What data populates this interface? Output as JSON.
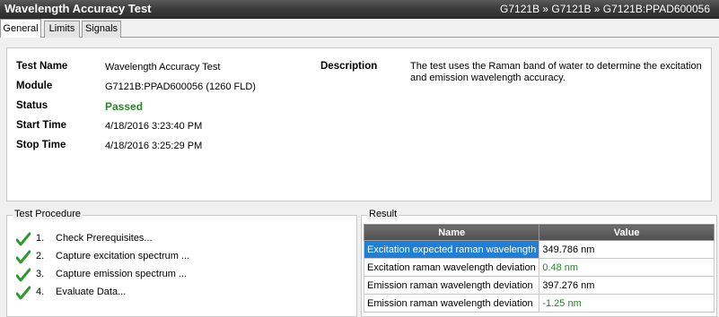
{
  "window": {
    "title": "Wavelength Accuracy Test",
    "breadcrumb": "G7121B » G7121B » G7121B:PPAD600056"
  },
  "tabs": [
    "General",
    "Limits",
    "Signals"
  ],
  "info": {
    "test_name_label": "Test Name",
    "test_name": "Wavelength Accuracy Test",
    "module_label": "Module",
    "module": "G7121B:PPAD600056 (1260 FLD)",
    "status_label": "Status",
    "status": "Passed",
    "start_label": "Start Time",
    "start": "4/18/2016 3:23:40 PM",
    "stop_label": "Stop Time",
    "stop": "4/18/2016 3:25:29 PM",
    "description_label": "Description",
    "description": "The test uses the Raman band of water to determine the excitation and emission wavelength accuracy."
  },
  "procedure": {
    "title": "Test Procedure",
    "steps": [
      {
        "num": "1.",
        "text": "Check Prerequisites..."
      },
      {
        "num": "2.",
        "text": "Capture excitation spectrum ..."
      },
      {
        "num": "3.",
        "text": "Capture emission spectrum ..."
      },
      {
        "num": "4.",
        "text": "Evaluate Data..."
      }
    ]
  },
  "result": {
    "title": "Result",
    "headers": [
      "Name",
      "Value"
    ],
    "rows": [
      {
        "name": "Excitation expected raman wavelength",
        "value": "349.786 nm"
      },
      {
        "name": "Excitation raman wavelength deviation",
        "value": "0.48 nm"
      },
      {
        "name": "Emission raman wavelength deviation",
        "value": "397.276 nm"
      },
      {
        "name": "Emission raman wavelength deviation",
        "value": "-1.25 nm"
      }
    ]
  },
  "colors": {
    "pass_green": "#1f8a1f",
    "selection_blue": "#1e7fd6",
    "titlebar": "#3c3c3c"
  }
}
